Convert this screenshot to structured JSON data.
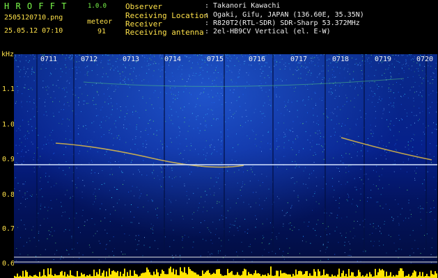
{
  "header": {
    "app_name": "H R O F F T",
    "version": "1.0.0",
    "filename": "2505120710.png",
    "datetime": "25.05.12 07:10",
    "meteor_label": "meteor",
    "meteor_count": "91",
    "info_labels": [
      "Observer",
      "Receiving Location",
      "Receiver",
      "Receiving antenna"
    ],
    "info_values": [
      ": Takanori Kawachi",
      ": Ogaki, Gifu, JAPAN (136.60E, 35.35N)",
      ": R820T2(RTL-SDR) SDR-Sharp 53.372MHz",
      ": 2el-HB9CV Vertical (el. E-W)"
    ]
  },
  "spectrogram": {
    "unit_label": "kHz",
    "time_labels": [
      "0711",
      "0712",
      "0713",
      "0714",
      "0715",
      "0716",
      "0717",
      "0718",
      "0719",
      "0720"
    ],
    "freq_labels": [
      "1.1",
      "1.0",
      "0.9",
      "0.8",
      "0.7",
      "0.6"
    ],
    "colors": {
      "text_green": "#7cfc4a",
      "text_yellow": "#ffe24a",
      "carrier": "#cfe0ff",
      "bar": "#ffe400"
    }
  }
}
